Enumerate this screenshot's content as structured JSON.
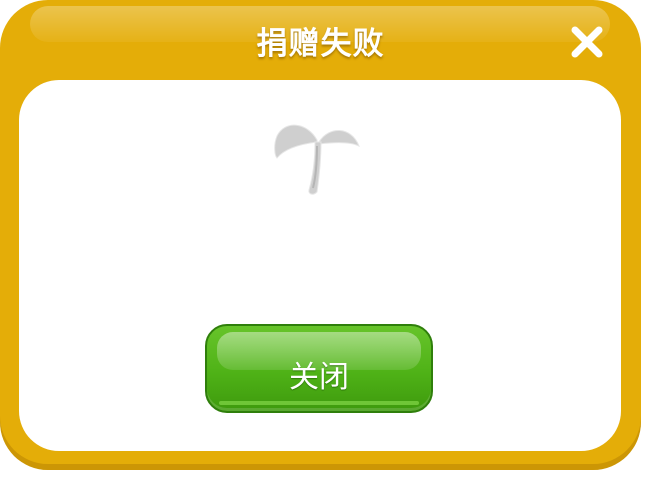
{
  "dialog": {
    "title": "捐赠失败",
    "close_icon": "close-x-icon",
    "illustration_icon": "sprout-icon",
    "close_button_label": "关闭"
  },
  "colors": {
    "frame": "#e4ad08",
    "button": "#4fb217",
    "sprout": "#c9c9c9"
  }
}
